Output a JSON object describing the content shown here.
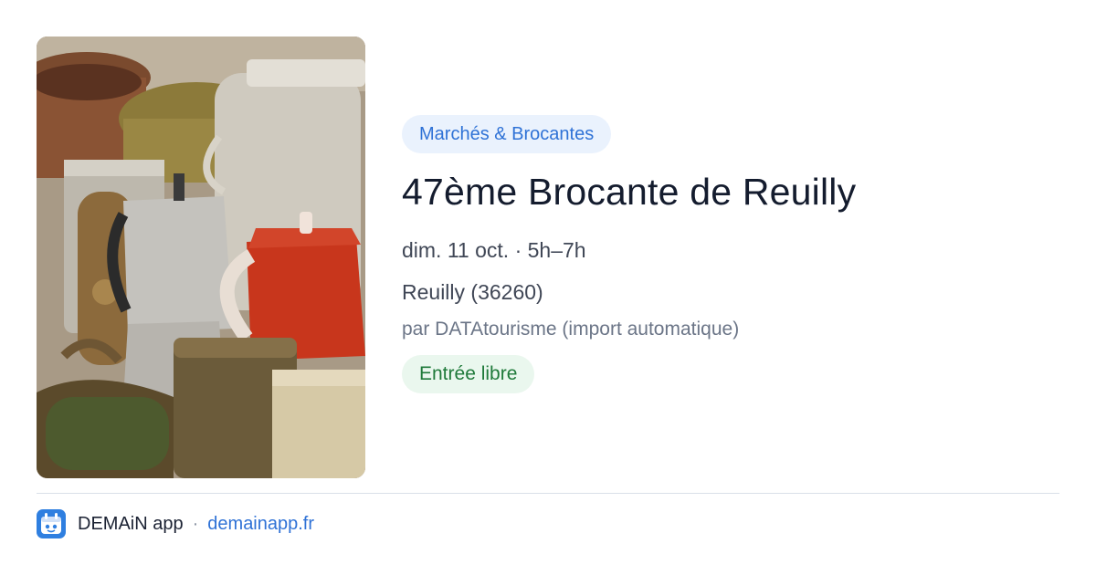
{
  "event": {
    "category": "Marchés & Brocantes",
    "title": "47ème Brocante de Reuilly",
    "datetime": "dim. 11 oct. · 5h–7h",
    "location": "Reuilly (36260)",
    "organizer": "par DATAtourisme (import automatique)",
    "price": "Entrée libre",
    "image_icon": "flea-market-photo"
  },
  "footer": {
    "app_icon": "demain-app-icon",
    "app_name": "DEMAiN app",
    "separator": "·",
    "link": "demainapp.fr"
  },
  "colors": {
    "category_bg": "#eaf2fd",
    "category_text": "#2f72d6",
    "price_bg": "#eaf7ee",
    "price_text": "#1f7a3a",
    "title": "#141c2e",
    "link": "#2f72d6"
  }
}
